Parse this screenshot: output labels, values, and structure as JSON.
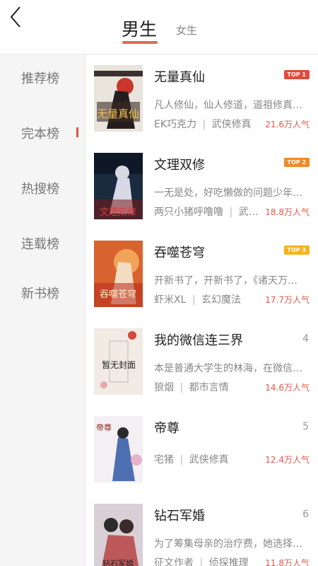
{
  "header": {
    "tab_male": "男生",
    "tab_female": "女生",
    "back_icon": "chevron-left-icon"
  },
  "sidebar": {
    "items": [
      {
        "label": "推荐榜"
      },
      {
        "label": "完本榜"
      },
      {
        "label": "热搜榜"
      },
      {
        "label": "连载榜"
      },
      {
        "label": "新书榜"
      }
    ],
    "active_index": 1
  },
  "books": [
    {
      "title": "无量真仙",
      "desc": "凡人修仙，仙人修道，道祖修真…",
      "author": "EK巧克力",
      "category": "武侠修真",
      "hot": "21.6万人气",
      "badge": "TOP 1",
      "badge_color": "#e24a3a",
      "cover_text": "无量真仙"
    },
    {
      "title": "文理双修",
      "desc": "一无是处，好吃懒做的问题少年…",
      "author": "两只小猪呼噜噜",
      "category": "武…",
      "hot": "18.8万人气",
      "badge": "TOP 2",
      "badge_color": "#f08a28",
      "cover_text": "文理双修"
    },
    {
      "title": "吞噬苍穹",
      "desc": "开新书了，开新书了，《诸天万…",
      "author": "虾米XL",
      "category": "玄幻魔法",
      "hot": "17.7万人气",
      "badge": "TOP 3",
      "badge_color": "#f5b21c",
      "cover_text": "吞噬苍穹"
    },
    {
      "title": "我的微信连三界",
      "desc": "本是普通大学生的林海，在微信…",
      "author": "狼烟",
      "category": "都市言情",
      "hot": "14.6万人气",
      "rank": "4",
      "cover_text": "暂无封面"
    },
    {
      "title": "帝尊",
      "desc": "",
      "author": "宅猪",
      "category": "武侠修真",
      "hot": "12.4万人气",
      "rank": "5",
      "cover_text": "帝尊"
    },
    {
      "title": "钻石军婚",
      "desc": "为了筹集母亲的治疗费，她选择…",
      "author": "征文作者",
      "category": "侦探推理",
      "hot": "11.8万人气",
      "rank": "6",
      "cover_text": "钻石军婚"
    }
  ]
}
